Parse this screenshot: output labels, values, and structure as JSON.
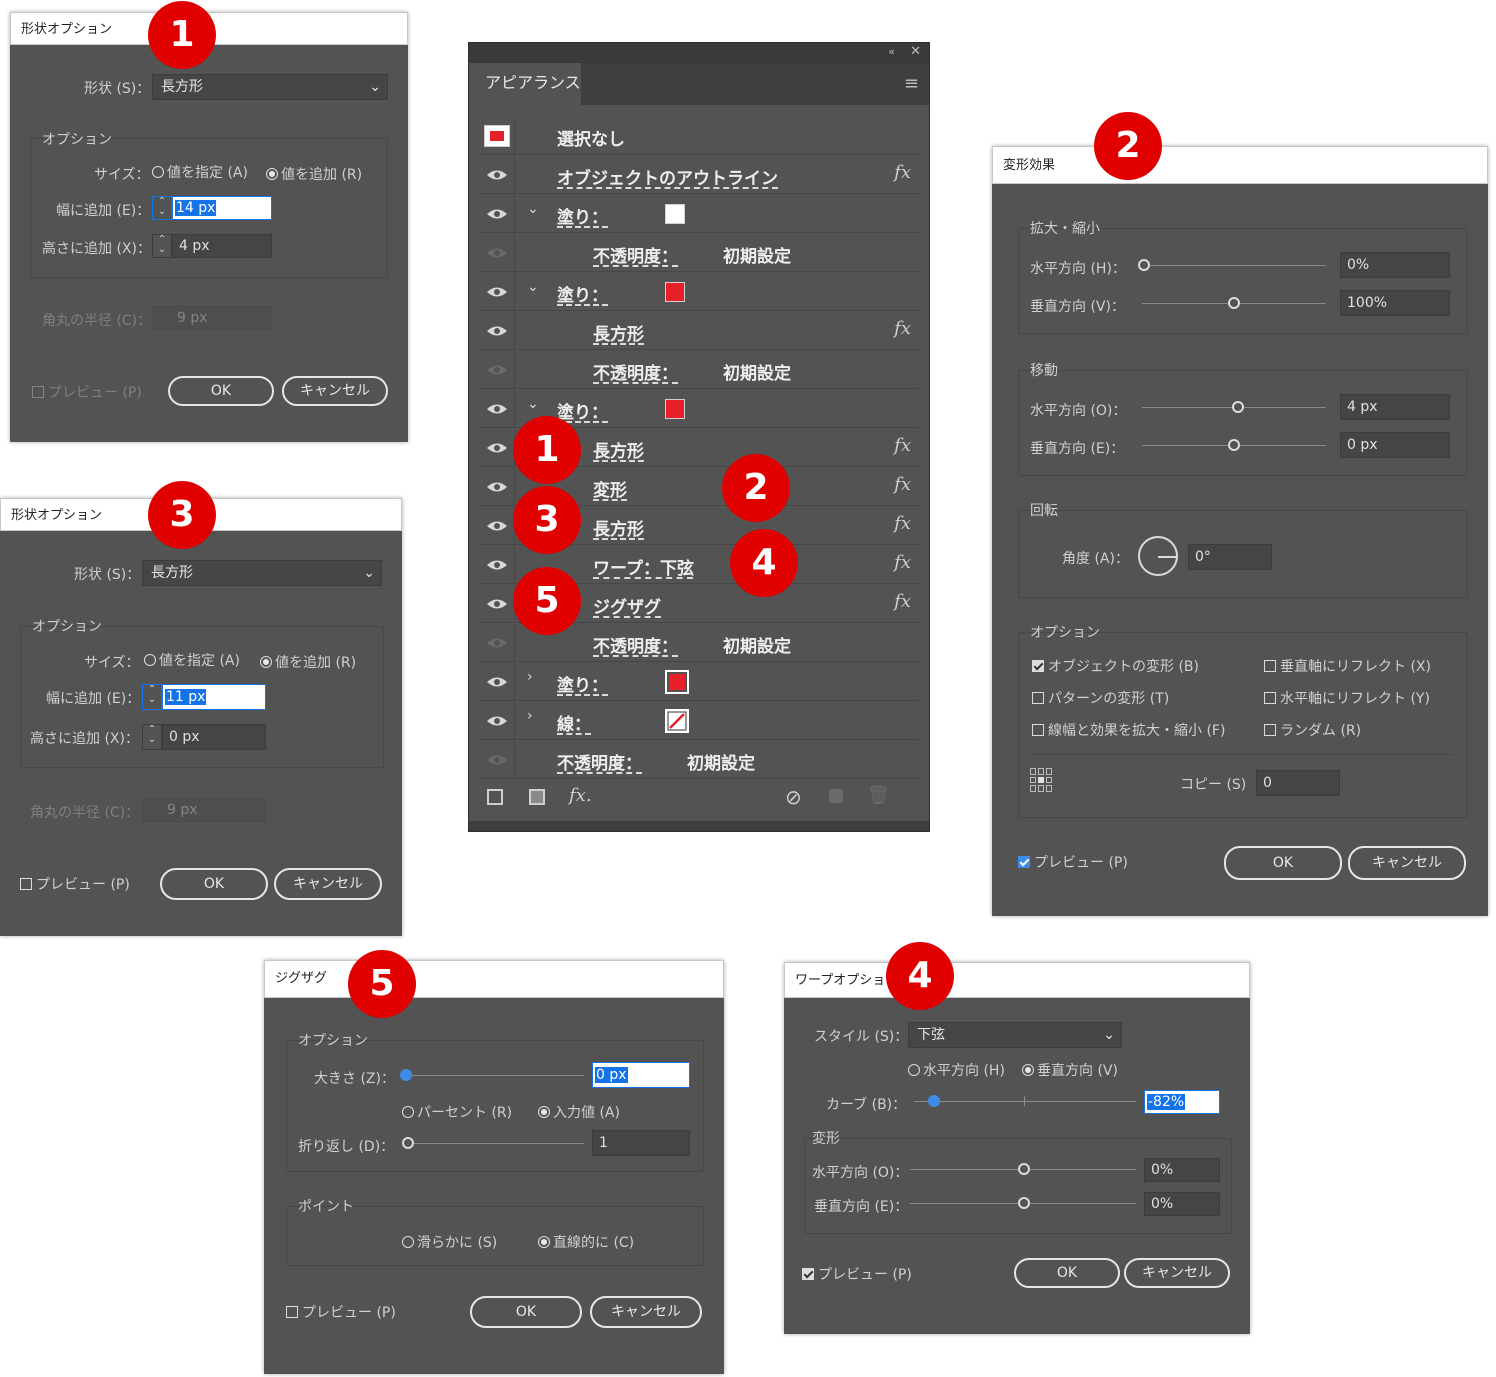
{
  "dialog1": {
    "title": "形状オプション",
    "badge": "1",
    "shape_label": "形状 (S)：",
    "shape_value": "長方形",
    "options_group": "オプション",
    "size_label": "サイズ：",
    "radio_specify": "値を指定 (A)",
    "radio_add": "値を追加 (R)",
    "width_label": "幅に追加 (E)：",
    "width_value": "14 px",
    "height_label": "高さに追加 (X)：",
    "height_value": "4 px",
    "corner_label": "角丸の半径 (C)：",
    "corner_value": "9 px",
    "preview_label": "プレビュー (P)",
    "ok": "OK",
    "cancel": "キャンセル"
  },
  "dialog3": {
    "title": "形状オプション",
    "badge": "3",
    "shape_label": "形状 (S)：",
    "shape_value": "長方形",
    "options_group": "オプション",
    "size_label": "サイズ：",
    "radio_specify": "値を指定 (A)",
    "radio_add": "値を追加 (R)",
    "width_label": "幅に追加 (E)：",
    "width_value": "11 px",
    "height_label": "高さに追加 (X)：",
    "height_value": "0 px",
    "corner_label": "角丸の半径 (C)：",
    "corner_value": "9 px",
    "preview_label": "プレビュー (P)",
    "ok": "OK",
    "cancel": "キャンセル"
  },
  "appearance": {
    "tab": "アピアランス",
    "rows": [
      {
        "label": "選択なし"
      },
      {
        "label": "オブジェクトのアウトライン",
        "fx": "fx"
      },
      {
        "label": "塗り：",
        "swatch": "#ffffff"
      },
      {
        "label": "不透明度：",
        "value": "初期設定"
      },
      {
        "label": "塗り：",
        "swatch": "#e8202a"
      },
      {
        "label": "長方形",
        "fx": "fx"
      },
      {
        "label": "不透明度：",
        "value": "初期設定"
      },
      {
        "label": "塗り：",
        "swatch": "#e8202a"
      },
      {
        "label": "長方形",
        "fx": "fx"
      },
      {
        "label": "変形",
        "fx": "fx"
      },
      {
        "label": "長方形",
        "fx": "fx"
      },
      {
        "label": "ワープ：下弦",
        "fx": "fx"
      },
      {
        "label": "ジグザグ",
        "fx": "fx"
      },
      {
        "label": "不透明度：",
        "value": "初期設定"
      },
      {
        "label": "塗り：",
        "swatch": "#e8202a"
      },
      {
        "label": "線："
      },
      {
        "label": "不透明度：",
        "value": "初期設定"
      }
    ],
    "fx_footer": "fx.",
    "badges": [
      "1",
      "2",
      "3",
      "4",
      "5"
    ]
  },
  "dialog2": {
    "title": "変形効果",
    "badge": "2",
    "scale_group": "拡大・縮小",
    "scale_h_label": "水平方向 (H)：",
    "scale_h_value": "0%",
    "scale_v_label": "垂直方向 (V)：",
    "scale_v_value": "100%",
    "move_group": "移動",
    "move_h_label": "水平方向 (O)：",
    "move_h_value": "4 px",
    "move_v_label": "垂直方向 (E)：",
    "move_v_value": "0 px",
    "rotate_group": "回転",
    "angle_label": "角度 (A)：",
    "angle_value": "0°",
    "options_group": "オプション",
    "opt_object": "オブジェクトの変形 (B)",
    "opt_pattern": "パターンの変形 (T)",
    "opt_stroke": "線幅と効果を拡大・縮小 (F)",
    "opt_reflect_x": "垂直軸にリフレクト (X)",
    "opt_reflect_y": "水平軸にリフレクト (Y)",
    "opt_random": "ランダム (R)",
    "copies_label": "コピー (S)",
    "copies_value": "0",
    "preview_label": "プレビュー (P)",
    "ok": "OK",
    "cancel": "キャンセル"
  },
  "dialog5": {
    "title": "ジグザグ",
    "badge": "5",
    "options_group": "オプション",
    "size_label": "大きさ (Z)：",
    "size_value": "0 px",
    "radio_percent": "パーセント (R)",
    "radio_absolute": "入力値 (A)",
    "ridges_label": "折り返し (D)：",
    "ridges_value": "1",
    "points_group": "ポイント",
    "radio_smooth": "滑らかに (S)",
    "radio_corner": "直線的に (C)",
    "preview_label": "プレビュー (P)",
    "ok": "OK",
    "cancel": "キャンセル"
  },
  "dialog4": {
    "title": "ワープオプション",
    "badge": "4",
    "style_label": "スタイル (S)：",
    "style_value": "下弦",
    "radio_horizontal": "水平方向 (H)",
    "radio_vertical": "垂直方向 (V)",
    "bend_label": "カーブ (B)：",
    "bend_value": "-82%",
    "distortion_group": "変形",
    "dist_h_label": "水平方向 (O)：",
    "dist_h_value": "0%",
    "dist_v_label": "垂直方向 (E)：",
    "dist_v_value": "0%",
    "preview_label": "プレビュー (P)",
    "ok": "OK",
    "cancel": "キャンセル"
  }
}
